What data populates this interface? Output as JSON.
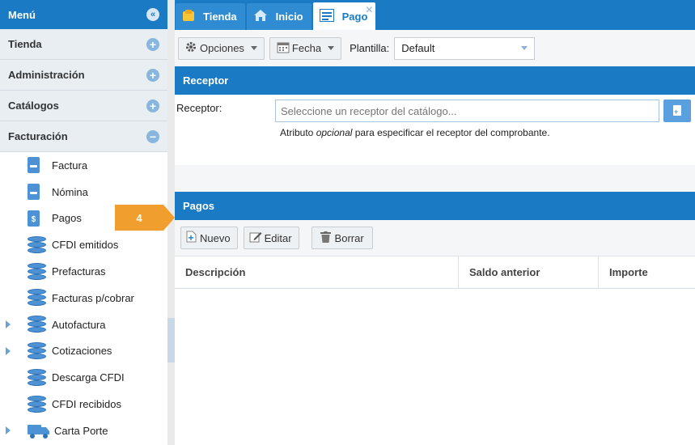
{
  "sidebar": {
    "title": "Menú",
    "sections": [
      {
        "label": "Tienda",
        "state": "collapsed"
      },
      {
        "label": "Administración",
        "state": "collapsed"
      },
      {
        "label": "Catálogos",
        "state": "collapsed"
      },
      {
        "label": "Facturación",
        "state": "expanded"
      }
    ],
    "items": [
      {
        "label": "Factura",
        "icon": "document-icon"
      },
      {
        "label": "Nómina",
        "icon": "document-icon"
      },
      {
        "label": "Pagos",
        "icon": "dollar-document-icon"
      },
      {
        "label": "CFDI emitidos",
        "icon": "database-icon"
      },
      {
        "label": "Prefacturas",
        "icon": "database-icon"
      },
      {
        "label": "Facturas p/cobrar",
        "icon": "database-icon"
      },
      {
        "label": "Autofactura",
        "icon": "database-icon",
        "expandable": true
      },
      {
        "label": "Cotizaciones",
        "icon": "database-icon",
        "expandable": true
      },
      {
        "label": "Descarga CFDI",
        "icon": "database-icon"
      },
      {
        "label": "CFDI recibidos",
        "icon": "database-icon"
      },
      {
        "label": "Carta Porte",
        "icon": "truck-icon",
        "expandable": true
      }
    ]
  },
  "step_badge": "4",
  "tabs": [
    {
      "label": "Tienda",
      "icon": "store-icon"
    },
    {
      "label": "Inicio",
      "icon": "home-icon"
    },
    {
      "label": "Pago",
      "icon": "form-icon",
      "active": true,
      "closable": true
    }
  ],
  "toolbar": {
    "opciones": "Opciones",
    "fecha": "Fecha",
    "plantilla_label": "Plantilla:",
    "plantilla_value": "Default"
  },
  "receptor": {
    "section_title": "Receptor",
    "label": "Receptor:",
    "placeholder": "Seleccione un receptor del catálogo...",
    "value": "",
    "help_before": "Atributo ",
    "help_em": "opcional",
    "help_after": " para especificar el receptor del comprobante."
  },
  "pagos": {
    "section_title": "Pagos",
    "buttons": {
      "nuevo": "Nuevo",
      "editar": "Editar",
      "borrar": "Borrar"
    },
    "columns": [
      "Descripción",
      "Saldo anterior",
      "Importe"
    ],
    "rows": []
  },
  "colors": {
    "primary": "#1a7bc4",
    "badge": "#f09f2e",
    "icon_blue": "#4d92d4"
  }
}
